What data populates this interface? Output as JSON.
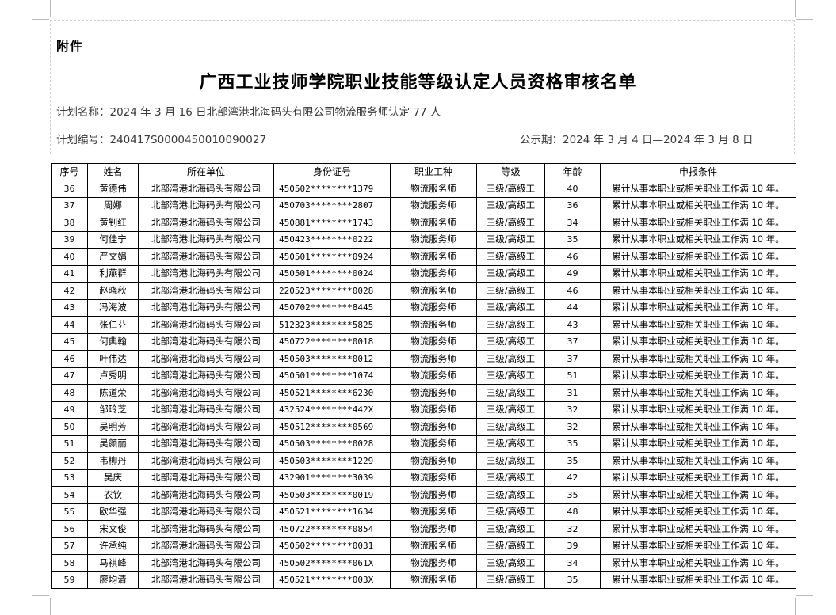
{
  "document": {
    "attachment_label": "附件",
    "title": "广西工业技师学院职业技能等级认定人员资格审核名单",
    "plan_name": "计划名称：2024 年 3 月 16 日北部湾港北海码头有限公司物流服务师认定 77 人",
    "plan_number": "计划编号：240417S0000450010090027",
    "publicity_period": "公示期：2024 年 3 月 4 日—2024 年 3 月 8 日"
  },
  "table": {
    "headers": [
      "序号",
      "姓名",
      "所在单位",
      "身份证号",
      "职业工种",
      "等级",
      "年龄",
      "申报条件"
    ],
    "rows": [
      [
        "36",
        "黄德伟",
        "北部湾港北海码头有限公司",
        "450502********1379",
        "物流服务师",
        "三级/高级工",
        "40",
        "累计从事本职业或相关职业工作满 10 年。"
      ],
      [
        "37",
        "周娜",
        "北部湾港北海码头有限公司",
        "450703********2807",
        "物流服务师",
        "三级/高级工",
        "36",
        "累计从事本职业或相关职业工作满 10 年。"
      ],
      [
        "38",
        "黄钊红",
        "北部湾港北海码头有限公司",
        "450881********1743",
        "物流服务师",
        "三级/高级工",
        "34",
        "累计从事本职业或相关职业工作满 10 年。"
      ],
      [
        "39",
        "何佳宁",
        "北部湾港北海码头有限公司",
        "450423********0222",
        "物流服务师",
        "三级/高级工",
        "35",
        "累计从事本职业或相关职业工作满 10 年。"
      ],
      [
        "40",
        "严文娟",
        "北部湾港北海码头有限公司",
        "450501********0924",
        "物流服务师",
        "三级/高级工",
        "46",
        "累计从事本职业或相关职业工作满 10 年。"
      ],
      [
        "41",
        "利燕群",
        "北部湾港北海码头有限公司",
        "450501********0024",
        "物流服务师",
        "三级/高级工",
        "49",
        "累计从事本职业或相关职业工作满 10 年。"
      ],
      [
        "42",
        "赵晓秋",
        "北部湾港北海码头有限公司",
        "220523********0028",
        "物流服务师",
        "三级/高级工",
        "46",
        "累计从事本职业或相关职业工作满 10 年。"
      ],
      [
        "43",
        "冯海波",
        "北部湾港北海码头有限公司",
        "450702********8445",
        "物流服务师",
        "三级/高级工",
        "44",
        "累计从事本职业或相关职业工作满 10 年。"
      ],
      [
        "44",
        "张仁芬",
        "北部湾港北海码头有限公司",
        "512323********5825",
        "物流服务师",
        "三级/高级工",
        "43",
        "累计从事本职业或相关职业工作满 10 年。"
      ],
      [
        "45",
        "何典翰",
        "北部湾港北海码头有限公司",
        "450722********0018",
        "物流服务师",
        "三级/高级工",
        "37",
        "累计从事本职业或相关职业工作满 10 年。"
      ],
      [
        "46",
        "叶伟达",
        "北部湾港北海码头有限公司",
        "450503********0012",
        "物流服务师",
        "三级/高级工",
        "37",
        "累计从事本职业或相关职业工作满 10 年。"
      ],
      [
        "47",
        "卢秀明",
        "北部湾港北海码头有限公司",
        "450501********1074",
        "物流服务师",
        "三级/高级工",
        "51",
        "累计从事本职业或相关职业工作满 10 年。"
      ],
      [
        "48",
        "陈道荣",
        "北部湾港北海码头有限公司",
        "450521********6230",
        "物流服务师",
        "三级/高级工",
        "31",
        "累计从事本职业或相关职业工作满 10 年。"
      ],
      [
        "49",
        "邹玲芝",
        "北部湾港北海码头有限公司",
        "432524********442X",
        "物流服务师",
        "三级/高级工",
        "32",
        "累计从事本职业或相关职业工作满 10 年。"
      ],
      [
        "50",
        "吴明芳",
        "北部湾港北海码头有限公司",
        "450512********0569",
        "物流服务师",
        "三级/高级工",
        "32",
        "累计从事本职业或相关职业工作满 10 年。"
      ],
      [
        "51",
        "吴颜丽",
        "北部湾港北海码头有限公司",
        "450503********0028",
        "物流服务师",
        "三级/高级工",
        "35",
        "累计从事本职业或相关职业工作满 10 年。"
      ],
      [
        "52",
        "韦柳丹",
        "北部湾港北海码头有限公司",
        "450503********1229",
        "物流服务师",
        "三级/高级工",
        "35",
        "累计从事本职业或相关职业工作满 10 年。"
      ],
      [
        "53",
        "吴庆",
        "北部湾港北海码头有限公司",
        "432901********3039",
        "物流服务师",
        "三级/高级工",
        "42",
        "累计从事本职业或相关职业工作满 10 年。"
      ],
      [
        "54",
        "农钦",
        "北部湾港北海码头有限公司",
        "450503********0019",
        "物流服务师",
        "三级/高级工",
        "35",
        "累计从事本职业或相关职业工作满 10 年。"
      ],
      [
        "55",
        "欧华强",
        "北部湾港北海码头有限公司",
        "450521********1634",
        "物流服务师",
        "三级/高级工",
        "48",
        "累计从事本职业或相关职业工作满 10 年。"
      ],
      [
        "56",
        "宋文俊",
        "北部湾港北海码头有限公司",
        "450722********0854",
        "物流服务师",
        "三级/高级工",
        "32",
        "累计从事本职业或相关职业工作满 10 年。"
      ],
      [
        "57",
        "许承纯",
        "北部湾港北海码头有限公司",
        "450502********0031",
        "物流服务师",
        "三级/高级工",
        "39",
        "累计从事本职业或相关职业工作满 10 年。"
      ],
      [
        "58",
        "马祺峰",
        "北部湾港北海码头有限公司",
        "450502********061X",
        "物流服务师",
        "三级/高级工",
        "34",
        "累计从事本职业或相关职业工作满 10 年。"
      ],
      [
        "59",
        "廖均清",
        "北部湾港北海码头有限公司",
        "450521********003X",
        "物流服务师",
        "三级/高级工",
        "35",
        "累计从事本职业或相关职业工作满 10 年。"
      ]
    ]
  }
}
